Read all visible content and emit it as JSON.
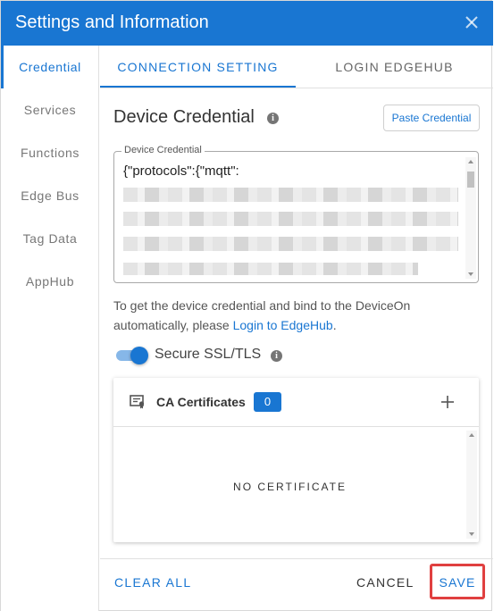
{
  "dialog": {
    "title": "Settings and Information",
    "close_icon": "close-icon"
  },
  "sidebar": {
    "items": [
      {
        "label": "Credential",
        "active": true
      },
      {
        "label": "Services",
        "active": false
      },
      {
        "label": "Functions",
        "active": false
      },
      {
        "label": "Edge Bus",
        "active": false
      },
      {
        "label": "Tag Data",
        "active": false
      },
      {
        "label": "AppHub",
        "active": false
      }
    ]
  },
  "tabs": [
    {
      "label": "CONNECTION SETTING",
      "active": true
    },
    {
      "label": "LOGIN EDGEHUB",
      "active": false
    }
  ],
  "credential": {
    "heading": "Device Credential",
    "info_icon": "info-icon",
    "paste_button": "Paste Credential",
    "field_label": "Device Credential",
    "field_value_visible": "{\"protocols\":{\"mqtt\":"
  },
  "hint": {
    "text": "To get the device credential and bind to the DeviceOn automatically, please ",
    "link": "Login to EdgeHub",
    "suffix": "."
  },
  "ssl": {
    "label": "Secure SSL/TLS",
    "enabled": true
  },
  "ca_certificates": {
    "title": "CA Certificates",
    "count": "0",
    "empty_text": "NO CERTIFICATE",
    "add_icon": "plus-icon"
  },
  "footer": {
    "clear_all": "CLEAR ALL",
    "cancel": "CANCEL",
    "save": "SAVE"
  },
  "colors": {
    "primary": "#1976d2",
    "highlight": "#e04040"
  }
}
